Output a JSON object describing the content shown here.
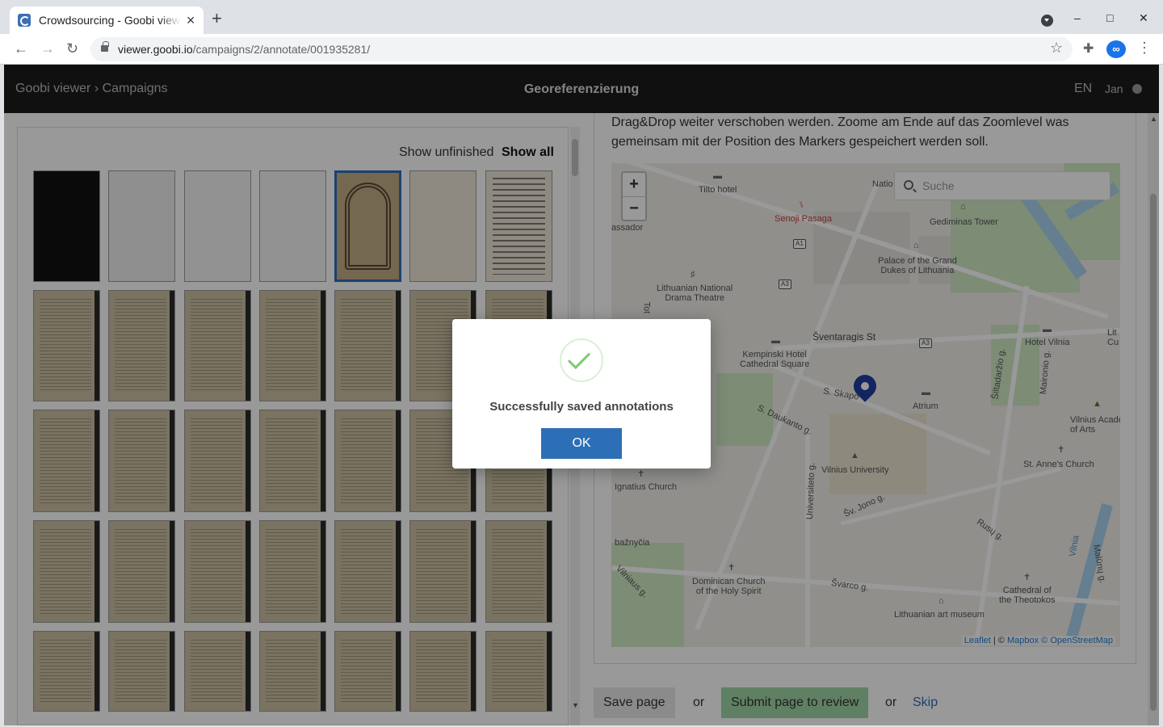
{
  "browser": {
    "tab_title": "Crowdsourcing - Goobi viewer",
    "url_host": "viewer.goobi.io",
    "url_path": "/campaigns/2/annotate/001935281/"
  },
  "header": {
    "breadcrumb": "Goobi viewer › Campaigns",
    "title": "Georeferenzierung",
    "language": "EN",
    "user": "Jan"
  },
  "thumbnails": {
    "filter_unfinished": "Show unfinished",
    "filter_all": "Show all"
  },
  "help_text": "Drag&Drop weiter verschoben werden. Zoome am Ende auf das Zoomlevel was gemeinsam mit der Position des Markers gespeichert werden soll.",
  "map": {
    "zoom_in": "+",
    "zoom_out": "−",
    "search_placeholder": "Suche",
    "labels": {
      "tilto": "Tilto hotel",
      "nation": "Natio",
      "senoji": "Senoji Pasaga",
      "gediminas": "Gediminas Tower",
      "palace": "Palace of the Grand\nDukes of Lithuania",
      "drama": "Lithuanian National\nDrama Theatre",
      "ambassador": "assador",
      "sventaragis": "Šventaragis St",
      "kempinski": "Kempinski Hotel\nCathedral Square",
      "hotel_vilnia": "Hotel Vilnia",
      "lit_cu": "Lit\nCu",
      "skapo": "S. Skapo",
      "atrium": "Atrium",
      "daukanto": "S. Daukanto g.",
      "vilnius_univ": "Vilnius University",
      "academy": "Vilnius Acade\nof Arts",
      "st_anne": "St. Anne's Church",
      "ignatius": "Ignatius Church",
      "universiteto": "Universiteto g.",
      "sv_jono": "Šv. Jono g.",
      "rusu": "Rusų g.",
      "baznycia": "bažnyčia",
      "dominican": "Dominican Church\nof the Holy Spirit",
      "svarco": "Švarco g.",
      "theotokos": "Cathedral of\nthe Theotokos",
      "art_museum": "Lithuanian art museum",
      "siltadarzio": "Šiltadaržio g.",
      "maironio": "Maironio g.",
      "maluny": "Malūnų g.",
      "vilnia": "Vilnia",
      "tot": "Tot",
      "vilniaus": "Vilniaus g.",
      "a1": "A1",
      "a3": "A3",
      "a3b": "A3"
    },
    "attribution_leaflet": "Leaflet",
    "attribution_sep": " | © ",
    "attribution_mapbox": "Mapbox",
    "attribution_osm": "© OpenStreetMap"
  },
  "actions": {
    "save": "Save page",
    "or1": "or",
    "submit": "Submit page to review",
    "or2": "or",
    "skip": "Skip"
  },
  "modal": {
    "message": "Successfully saved annotations",
    "ok": "OK"
  }
}
